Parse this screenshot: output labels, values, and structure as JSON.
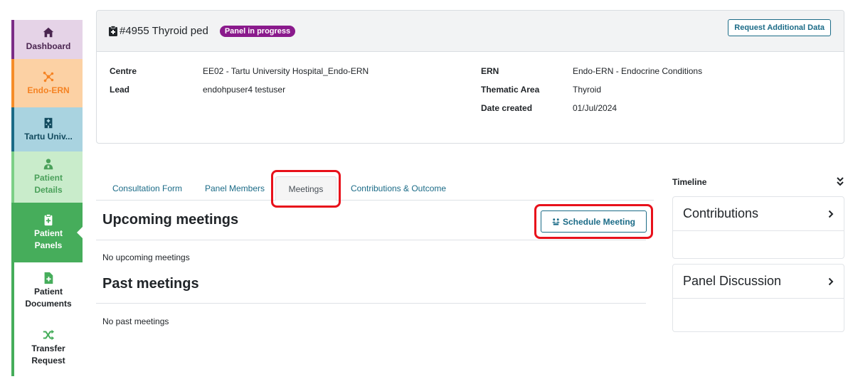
{
  "sidebar": {
    "items": [
      {
        "label": "Dashboard",
        "icon": "home-icon"
      },
      {
        "label": "Endo-ERN",
        "icon": "network-icon"
      },
      {
        "label": "Tartu Univ...",
        "icon": "hospital-icon"
      },
      {
        "label": "Patient Details",
        "icon": "patient-icon"
      },
      {
        "label": "Patient Panels",
        "icon": "clipboard-icon"
      },
      {
        "label": "Patient Documents",
        "icon": "document-add-icon"
      },
      {
        "label": "Transfer Request",
        "icon": "shuffle-icon"
      }
    ]
  },
  "case": {
    "title": "#4955 Thyroid ped",
    "status": "Panel in progress",
    "request_button": "Request Additional Data",
    "fields": {
      "centre_label": "Centre",
      "centre_value": "EE02 - Tartu University Hospital_Endo-ERN",
      "lead_label": "Lead",
      "lead_value": "endohpuser4 testuser",
      "ern_label": "ERN",
      "ern_value": "Endo-ERN - Endocrine Conditions",
      "thematic_label": "Thematic Area",
      "thematic_value": "Thyroid",
      "date_label": "Date created",
      "date_value": "01/Jul/2024"
    }
  },
  "tabs": [
    {
      "label": "Consultation Form"
    },
    {
      "label": "Panel Members"
    },
    {
      "label": "Meetings",
      "active": true
    },
    {
      "label": "Contributions & Outcome"
    }
  ],
  "meetings": {
    "upcoming_title": "Upcoming meetings",
    "schedule_button": "Schedule Meeting",
    "no_upcoming": "No upcoming meetings",
    "past_title": "Past meetings",
    "no_past": "No past meetings"
  },
  "timeline": {
    "title": "Timeline",
    "cards": [
      {
        "label": "Contributions"
      },
      {
        "label": "Panel Discussion"
      }
    ]
  },
  "colors": {
    "accent": "#1b6b87",
    "badge": "#8a1a8c",
    "highlight": "#e8111b",
    "panels_active": "#46ad5b"
  }
}
